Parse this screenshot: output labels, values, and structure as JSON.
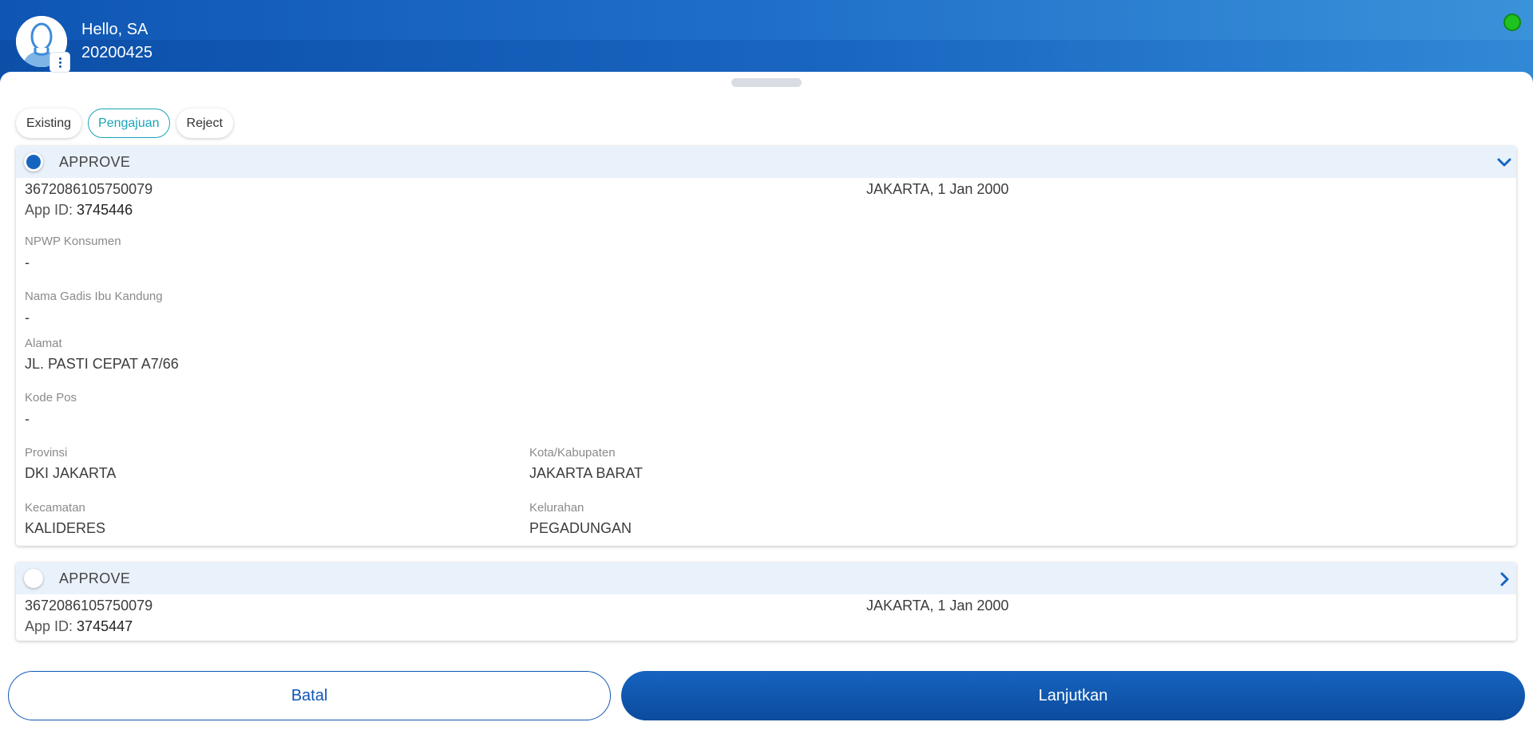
{
  "header": {
    "greeting": "Hello, SA",
    "user_id": "20200425",
    "status_color": "#1fc21f"
  },
  "tabs": [
    {
      "label": "Existing",
      "active": false
    },
    {
      "label": "Pengajuan",
      "active": true
    },
    {
      "label": "Reject",
      "active": false
    }
  ],
  "applications": [
    {
      "status": "APPROVE",
      "selected": true,
      "expanded": true,
      "nik": "3672086105750079",
      "birth": "JAKARTA, 1 Jan 2000",
      "app_id_label": "App ID:",
      "app_id": "3745446",
      "details": {
        "npwp": {
          "label": "NPWP Konsumen",
          "value": "-"
        },
        "mother_name": {
          "label": "Nama Gadis Ibu Kandung",
          "value": "-"
        },
        "address": {
          "label": "Alamat",
          "value": "JL. PASTI CEPAT A7/66"
        },
        "postal_code": {
          "label": "Kode Pos",
          "value": "-"
        },
        "province": {
          "label": "Provinsi",
          "value": "DKI JAKARTA"
        },
        "city": {
          "label": "Kota/Kabupaten",
          "value": "JAKARTA BARAT"
        },
        "district": {
          "label": "Kecamatan",
          "value": "KALIDERES"
        },
        "subdistrict": {
          "label": "Kelurahan",
          "value": "PEGADUNGAN"
        }
      }
    },
    {
      "status": "APPROVE",
      "selected": false,
      "expanded": false,
      "nik": "3672086105750079",
      "birth": "JAKARTA, 1 Jan 2000",
      "app_id_label": "App ID:",
      "app_id": "3745447"
    }
  ],
  "actions": {
    "cancel_label": "Batal",
    "continue_label": "Lanjutkan"
  },
  "colors": {
    "primary": "#0f56b3",
    "accent_tab": "#1aa3b8",
    "card_header_bg": "#e9f1fb"
  },
  "icons": {
    "avatar": "user-avatar-icon",
    "menu": "more-vertical-icon",
    "expanded": "chevron-down-icon",
    "collapsed": "chevron-right-icon"
  }
}
